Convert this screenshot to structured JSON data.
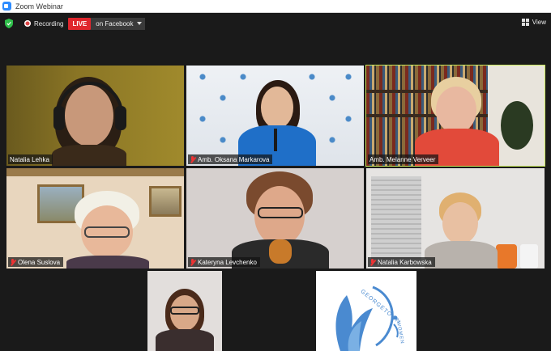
{
  "window": {
    "title": "Zoom Webinar"
  },
  "toolbar": {
    "recording_label": "Recording",
    "live_label": "LIVE",
    "live_destination": "on Facebook",
    "view_label": "View"
  },
  "participants": [
    {
      "name": "Natalia Lehka",
      "muted": false
    },
    {
      "name": "Amb. Oksana Markarova",
      "muted": true
    },
    {
      "name": "Amb. Melanne Verveer",
      "muted": false,
      "active_speaker": true
    },
    {
      "name": "Olena Suslova",
      "muted": true
    },
    {
      "name": "Kateryna Levchenko",
      "muted": true
    },
    {
      "name": "Natalia Karbowska",
      "muted": true
    },
    {
      "name": "",
      "muted": false
    },
    {
      "name": "",
      "muted": false
    }
  ],
  "logo": {
    "text": "GEORGETOWN",
    "subtext": "WOMEN"
  },
  "colors": {
    "live": "#e0262d",
    "active_border": "#c8e85a",
    "shield": "#2fbf4a"
  }
}
